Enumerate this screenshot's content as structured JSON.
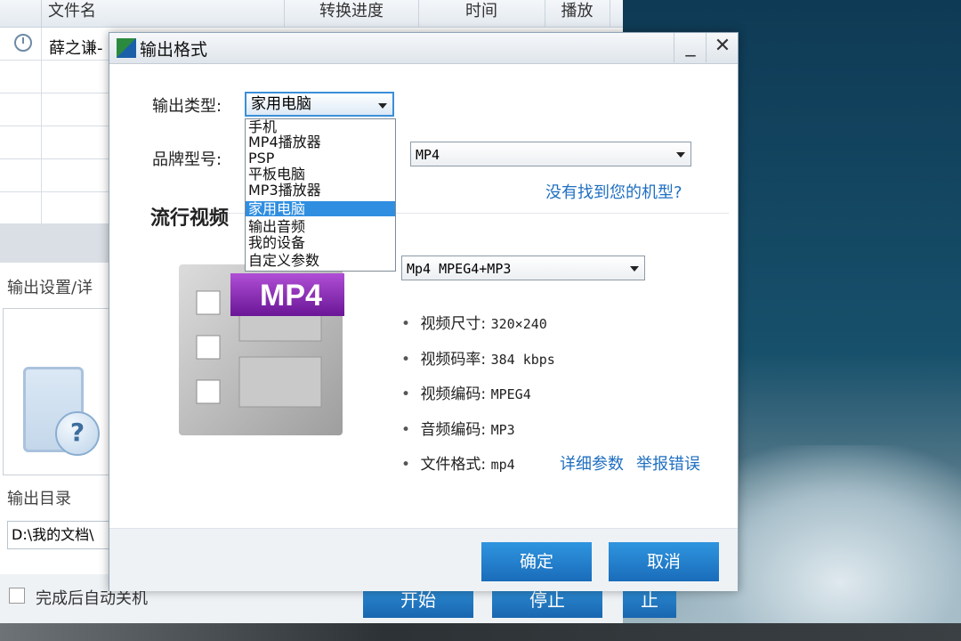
{
  "main": {
    "columns": [
      "文件名",
      "转换进度",
      "时间",
      "播放"
    ],
    "row1": {
      "filename": "薛之谦-"
    },
    "output_settings_label": "输出设置/详",
    "output_dir_label": "输出目录",
    "output_dir_value": "D:\\我的文档\\",
    "shutdown_label": "完成后自动关机",
    "start_button": "开始",
    "stop_button": "停止",
    "hidden_button_fragment": "止"
  },
  "dialog": {
    "title": "输出格式",
    "minimize": "_",
    "close": "✕",
    "output_type_label": "输出类型:",
    "output_type_value": "家用电脑",
    "dropdown_options": [
      "手机",
      "MP4播放器",
      "PSP",
      "平板电脑",
      "MP3播放器",
      "家用电脑",
      "输出音频",
      "我的设备",
      "自定义参数"
    ],
    "dropdown_selected_index": 5,
    "brand_label": "品牌型号:",
    "brand_value": "MP4",
    "model_link": "没有找到您的机型?",
    "popular_heading": "流行视频",
    "format_value": "Mp4 MPEG4+MP3",
    "format_badge": "MP4",
    "specs": {
      "video_size_label": "视频尺寸:",
      "video_size": "320×240",
      "video_bitrate_label": "视频码率:",
      "video_bitrate": "384 kbps",
      "video_codec_label": "视频编码:",
      "video_codec": "MPEG4",
      "audio_codec_label": "音频编码:",
      "audio_codec": "MP3",
      "file_format_label": "文件格式:",
      "file_format": "mp4"
    },
    "detail_link": "详细参数",
    "report_link": "举报错误",
    "ok_button": "确定",
    "cancel_button": "取消"
  },
  "colors": {
    "accent": "#1f6fc0",
    "button": "#1a6cba",
    "badge": "#7a1fa6"
  }
}
